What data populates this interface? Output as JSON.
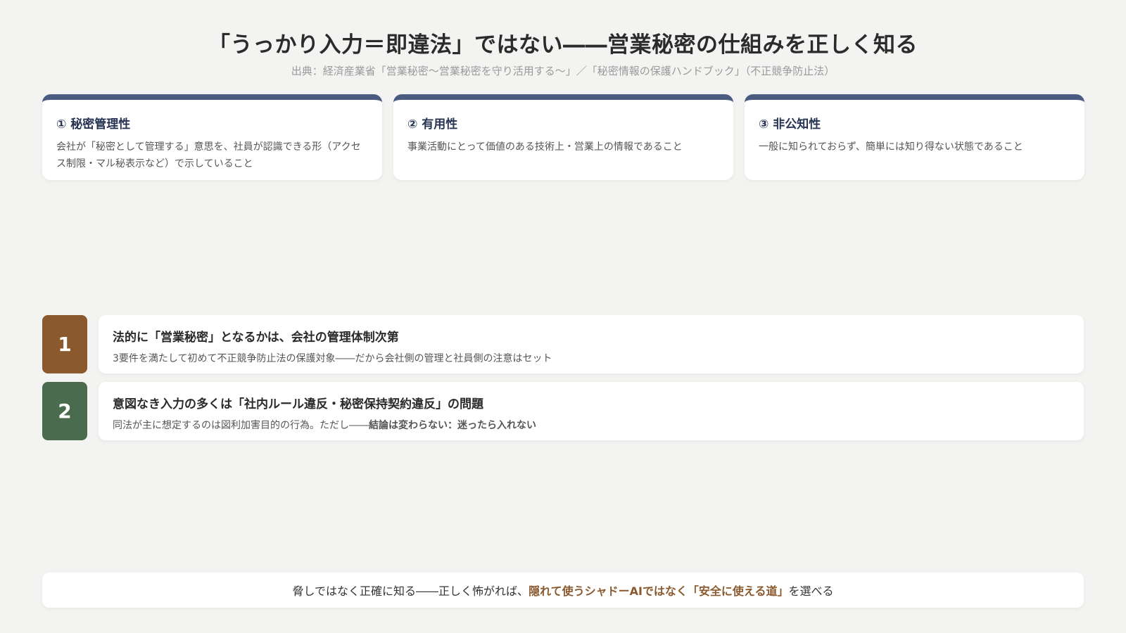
{
  "header": {
    "title": "「うっかり入力＝即違法」ではない――営業秘密の仕組みを正しく知る",
    "source": "出典：経済産業省「営業秘密～営業秘密を守り活用する～」／「秘密情報の保護ハンドブック」（不正競争防止法）"
  },
  "requirements": [
    {
      "title": "① 秘密管理性",
      "body": "会社が「秘密として管理する」意思を、社員が認識できる形（アクセス制限・マル秘表示など）で示していること"
    },
    {
      "title": "② 有用性",
      "body": "事業活動にとって価値のある技術上・営業上の情報であること"
    },
    {
      "title": "③ 非公知性",
      "body": "一般に知られておらず、簡単には知り得ない状態であること"
    }
  ],
  "points": [
    {
      "number": "1",
      "title": "法的に「営業秘密」となるかは、会社の管理体制次第",
      "body": "3要件を満たして初めて不正競争防止法の保護対象――だから会社側の管理と社員側の注意はセット",
      "body_strong": ""
    },
    {
      "number": "2",
      "title": "意図なき入力の多くは「社内ルール違反・秘密保持契約違反」の問題",
      "body": "同法が主に想定するのは図利加害目的の行為。ただし――",
      "body_strong": "結論は変わらない：迷ったら入れない"
    }
  ],
  "footer": {
    "text_before": "脅しではなく正確に知る――正しく怖がれば、",
    "accent": "隠れて使うシャドーAIではなく「安全に使える道」",
    "text_after": "を選べる"
  },
  "colors": {
    "card_accent": "#4a5a80",
    "badge_1": "#8a5a2e",
    "badge_2": "#4a6b4e",
    "footer_accent": "#8a5a2e"
  }
}
